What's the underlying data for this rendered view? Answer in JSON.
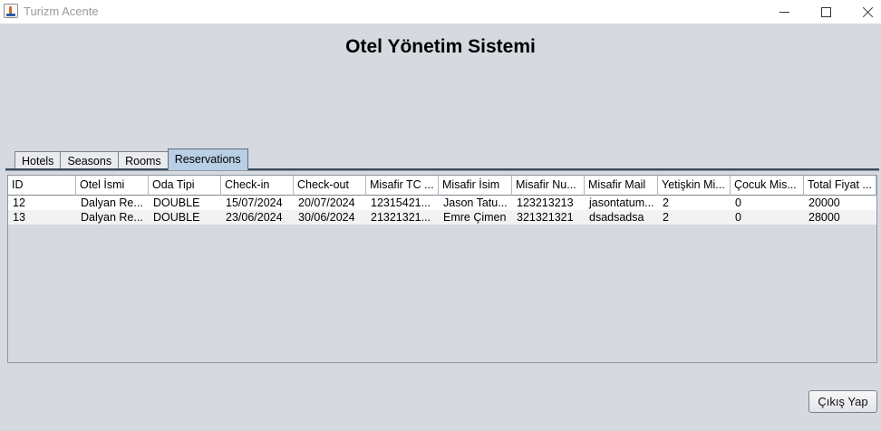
{
  "window": {
    "title": "Turizm Acente",
    "icon": "java-cup-icon"
  },
  "heading": "Otel Yönetim Sistemi",
  "tabs": [
    {
      "label": "Hotels",
      "selected": false
    },
    {
      "label": "Seasons",
      "selected": false
    },
    {
      "label": "Rooms",
      "selected": false
    },
    {
      "label": "Reservations",
      "selected": true
    }
  ],
  "table": {
    "headers": [
      "ID",
      "Otel İsmi",
      "Oda Tipi",
      "Check-in",
      "Check-out",
      "Misafir TC ...",
      "Misafir İsim",
      "Misafir Nu...",
      "Misafir Mail",
      "Yetişkin Mi...",
      "Çocuk Mis...",
      "Total Fiyat ..."
    ],
    "rows": [
      [
        "12",
        "Dalyan Re...",
        "DOUBLE",
        "15/07/2024",
        "20/07/2024",
        "12315421...",
        "Jason Tatu...",
        "123213213",
        "jasontatum...",
        "2",
        "0",
        "20000"
      ],
      [
        "13",
        "Dalyan Re...",
        "DOUBLE",
        "23/06/2024",
        "30/06/2024",
        "21321321...",
        "Emre Çimen",
        "321321321",
        "dsadsadsa",
        "2",
        "0",
        "28000"
      ]
    ]
  },
  "logout_label": "Çıkış Yap"
}
